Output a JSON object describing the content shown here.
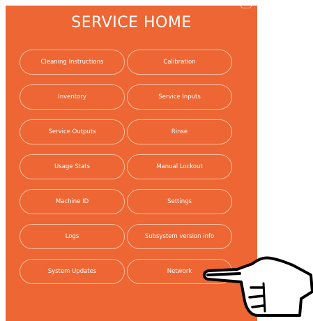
{
  "screen": {
    "title": "SERVICE HOME",
    "accent_color": "#ee6633",
    "text_color": "#ffffff"
  },
  "menu": {
    "buttons": [
      {
        "label": "Cleaning Instructions"
      },
      {
        "label": "Calibration"
      },
      {
        "label": "Inventory"
      },
      {
        "label": "Service Inputs"
      },
      {
        "label": "Service Outputs"
      },
      {
        "label": "Rinse"
      },
      {
        "label": "Usage Stats"
      },
      {
        "label": "Manual Lockout"
      },
      {
        "label": "Machine ID"
      },
      {
        "label": "Settings"
      },
      {
        "label": "Logs"
      },
      {
        "label": "Subsystem version info"
      },
      {
        "label": "System Updates"
      },
      {
        "label": "Network"
      }
    ]
  },
  "annotation": {
    "icon": "pointing-hand-icon"
  }
}
